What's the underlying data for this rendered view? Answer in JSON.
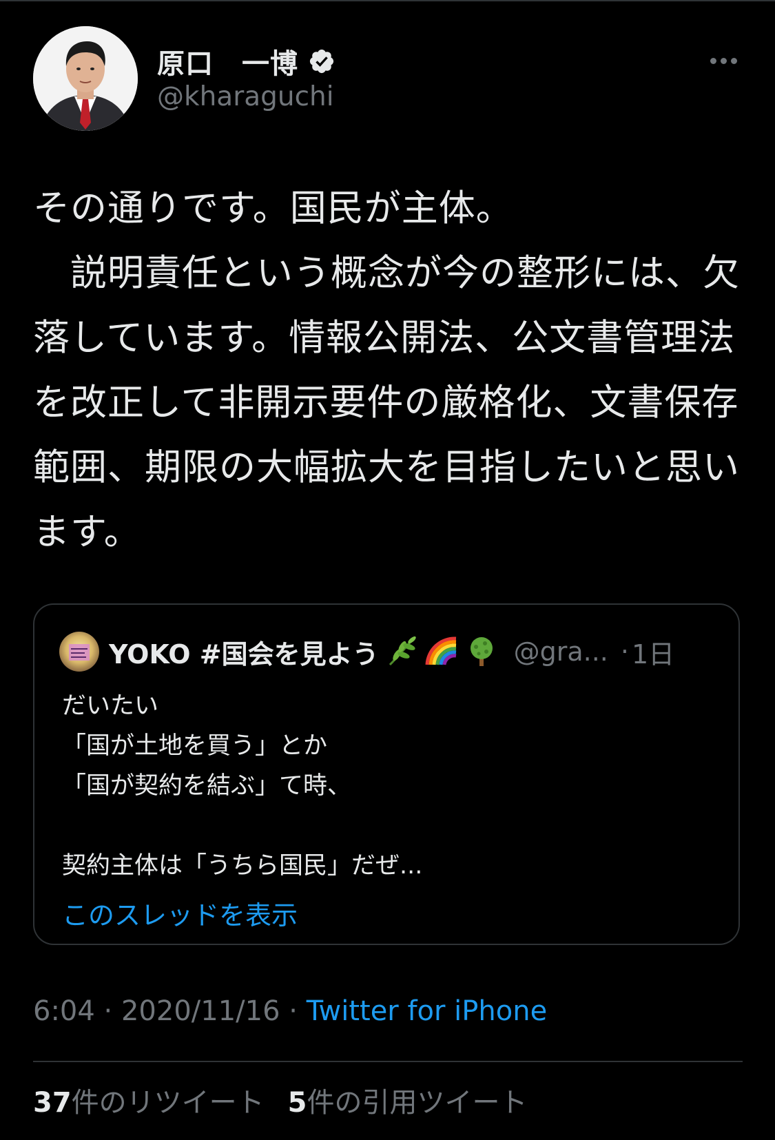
{
  "author": {
    "display_name": "原口　一博",
    "handle": "@kharaguchi",
    "verified": true,
    "avatar": "profile-photo"
  },
  "tweet": {
    "text": "その通りです。国民が主体。\n　説明責任という概念が今の整形には、欠落しています。情報公開法、公文書管理法を改正して非開示要件の厳格化、文書保存範囲、期限の大幅拡大を目指したいと思います。",
    "time": "6:04",
    "dot": "·",
    "date": "2020/11/16",
    "source": "Twitter for iPhone"
  },
  "quoted": {
    "display_name": "YOKO #国会を見よう",
    "emojis": [
      "herb-emoji",
      "rainbow-emoji",
      "tree-emoji"
    ],
    "handle": "@gra...",
    "dot": "·",
    "time": "1日",
    "text": "だいたい\n「国が土地を買う」とか\n「国が契約を結ぶ」て時、\n\n契約主体は「うちら国民」だぜ...",
    "show_thread": "このスレッドを表示"
  },
  "stats": {
    "retweets_count": "37",
    "retweets_label": "件のリツイート",
    "quotes_count": "5",
    "quotes_label": "件の引用ツイート"
  },
  "colors": {
    "background": "#000000",
    "text": "#e7e9ea",
    "muted": "#71767b",
    "accent": "#1d9bf0",
    "border": "#2f3336"
  },
  "icons": [
    "verified-badge-icon",
    "more-icon"
  ]
}
